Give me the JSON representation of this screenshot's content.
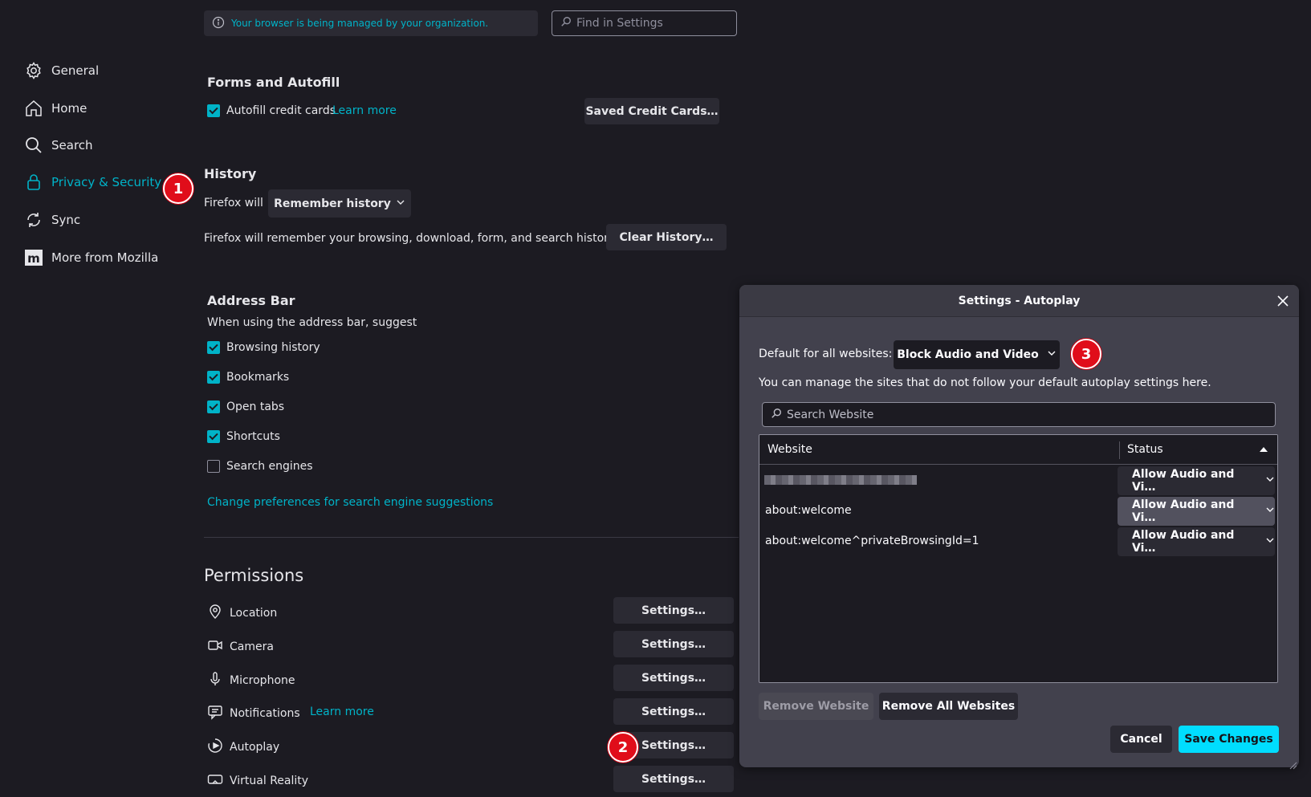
{
  "sidebar": {
    "items": [
      {
        "label": "General",
        "icon": "gear-icon"
      },
      {
        "label": "Home",
        "icon": "home-icon"
      },
      {
        "label": "Search",
        "icon": "search-icon"
      },
      {
        "label": "Privacy & Security",
        "icon": "lock-icon",
        "active": true
      },
      {
        "label": "Sync",
        "icon": "sync-icon"
      },
      {
        "label": "More from Mozilla",
        "icon": "mozilla-icon"
      }
    ]
  },
  "markers": {
    "m1": "1",
    "m2": "2",
    "m3": "3"
  },
  "header": {
    "managed_text": "Your browser is being managed by your organization.",
    "find_placeholder": "Find in Settings"
  },
  "forms": {
    "title": "Forms and Autofill",
    "autofill_label": "Autofill credit cards",
    "autofill_checked": true,
    "learn_more": "Learn more",
    "saved_cards_button": "Saved Credit Cards…"
  },
  "history": {
    "title": "History",
    "firefox_will": "Firefox will",
    "mode_select": "Remember history",
    "description": "Firefox will remember your browsing, download, form, and search history.",
    "clear_button": "Clear History…"
  },
  "address_bar": {
    "title": "Address Bar",
    "subtitle": "When using the address bar, suggest",
    "options": [
      {
        "label": "Browsing history",
        "checked": true
      },
      {
        "label": "Bookmarks",
        "checked": true
      },
      {
        "label": "Open tabs",
        "checked": true
      },
      {
        "label": "Shortcuts",
        "checked": true
      },
      {
        "label": "Search engines",
        "checked": false
      }
    ],
    "change_prefs_link": "Change preferences for search engine suggestions"
  },
  "permissions": {
    "title": "Permissions",
    "settings_label": "Settings…",
    "notifications_learn_more": "Learn more",
    "items": [
      {
        "label": "Location",
        "icon": "location-icon"
      },
      {
        "label": "Camera",
        "icon": "camera-icon"
      },
      {
        "label": "Microphone",
        "icon": "microphone-icon"
      },
      {
        "label": "Notifications",
        "icon": "notifications-icon"
      },
      {
        "label": "Autoplay",
        "icon": "autoplay-icon"
      },
      {
        "label": "Virtual Reality",
        "icon": "vr-icon"
      }
    ]
  },
  "dialog": {
    "title": "Settings - Autoplay",
    "default_label": "Default for all websites:",
    "default_value": "Block Audio and Video",
    "manage_text": "You can manage the sites that do not follow your default autoplay settings here.",
    "search_placeholder": "Search Website",
    "columns": {
      "website": "Website",
      "status": "Status"
    },
    "rows": [
      {
        "site": "",
        "status": "Allow Audio and Vi…",
        "blurred": true
      },
      {
        "site": "about:welcome",
        "status": "Allow Audio and Vi…"
      },
      {
        "site": "about:welcome^privateBrowsingId=1",
        "status": "Allow Audio and Vi…"
      }
    ],
    "remove_website": "Remove Website",
    "remove_all": "Remove All Websites",
    "cancel": "Cancel",
    "save": "Save Changes"
  },
  "colors": {
    "background": "#1c1b22",
    "accent": "#00b3c8",
    "primary_button": "#00ddff",
    "marker": "#e00d1a"
  }
}
